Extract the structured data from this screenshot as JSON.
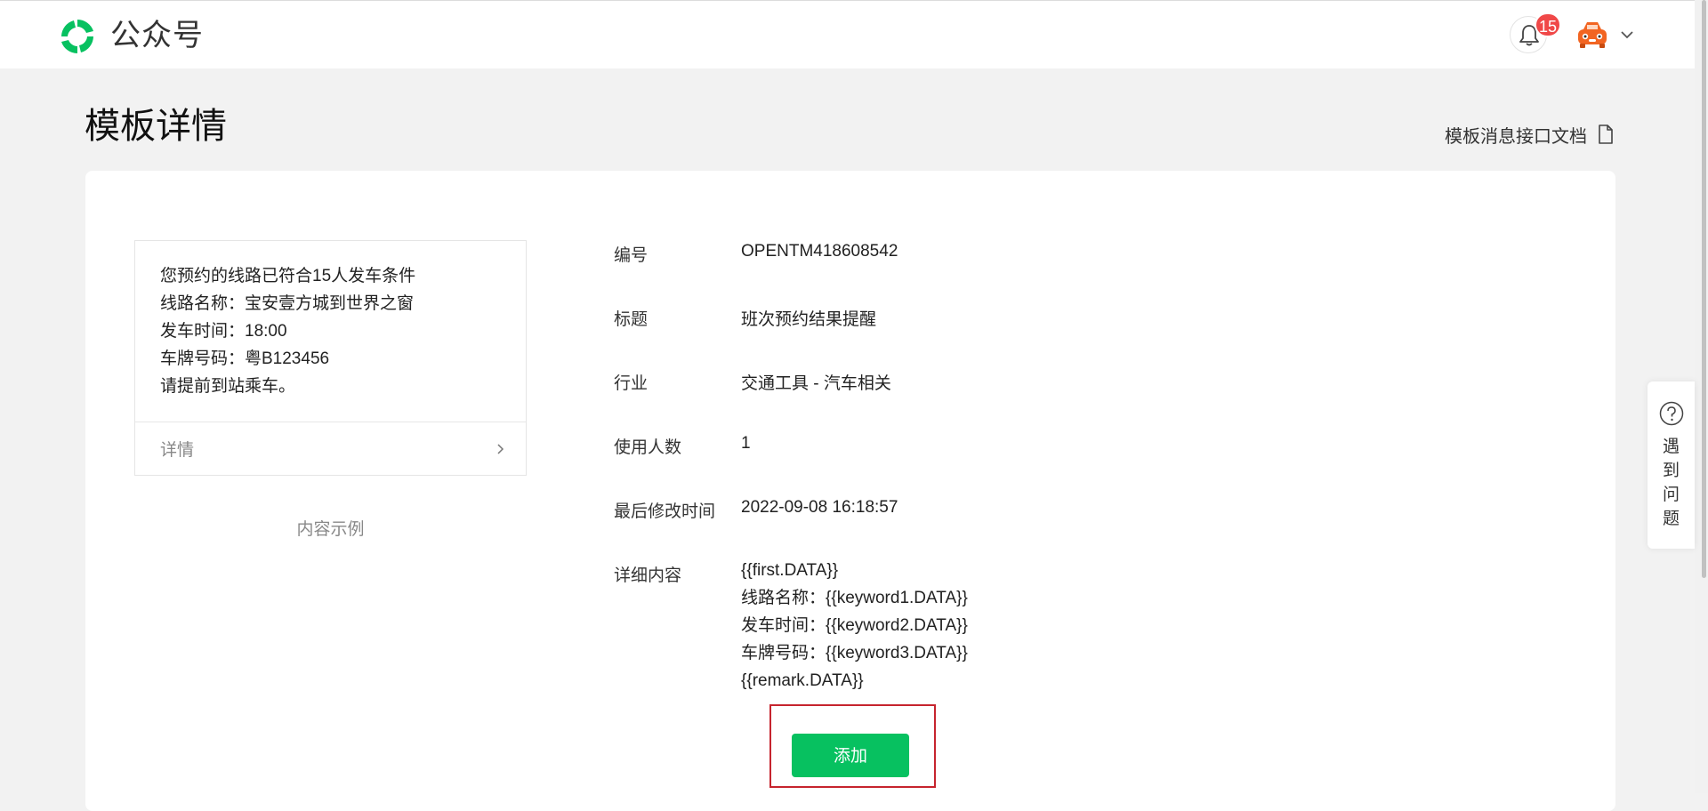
{
  "header": {
    "brand_name": "公众号",
    "notification_count": "15",
    "brand_color": "#07c160"
  },
  "page": {
    "title": "模板详情",
    "doc_link_label": "模板消息接口文档"
  },
  "preview": {
    "lines": [
      "您预约的线路已符合15人发车条件",
      "线路名称：宝安壹方城到世界之窗",
      "发车时间：18:00",
      "车牌号码：粤B123456",
      "请提前到站乘车。"
    ],
    "detail_label": "详情",
    "caption": "内容示例"
  },
  "details": {
    "id_label": "编号",
    "id_value": "OPENTM418608542",
    "title_label": "标题",
    "title_value": "班次预约结果提醒",
    "industry_label": "行业",
    "industry_value": "交通工具 - 汽车相关",
    "users_label": "使用人数",
    "users_value": "1",
    "modified_label": "最后修改时间",
    "modified_value": "2022-09-08 16:18:57",
    "content_label": "详细内容",
    "content_lines": [
      "{{first.DATA}}",
      "线路名称：{{keyword1.DATA}}",
      "发车时间：{{keyword2.DATA}}",
      "车牌号码：{{keyword3.DATA}}",
      "{{remark.DATA}}"
    ]
  },
  "actions": {
    "add_label": "添加",
    "highlight_color": "#c6242e"
  },
  "help": {
    "chars": [
      "遇",
      "到",
      "问",
      "题"
    ]
  },
  "icons": {
    "logo": "wechat-official-account-logo",
    "bell": "bell-icon",
    "avatar": "car-avatar",
    "chevron": "chevron-down-icon",
    "doc": "document-icon",
    "detail_arrow": "chevron-right-icon",
    "help": "question-circle-icon"
  }
}
